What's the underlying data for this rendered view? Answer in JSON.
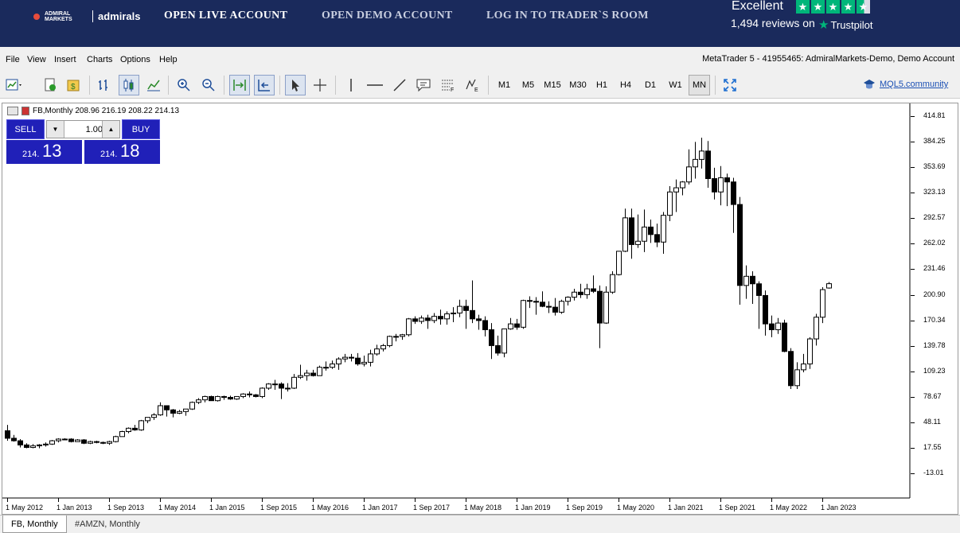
{
  "topbar": {
    "logo_small": "ADMIRAL MARKETS",
    "logo_big": "admirals",
    "links": [
      "OPEN LIVE ACCOUNT",
      "OPEN DEMO ACCOUNT",
      "LOG IN TO TRADER`S ROOM"
    ],
    "trustpilot": {
      "rating_word": "Excellent",
      "reviews": "1,494 reviews on",
      "brand": "Trustpilot",
      "stars": 4.5
    }
  },
  "menu": {
    "items": [
      "File",
      "View",
      "Insert",
      "Charts",
      "Options",
      "Help"
    ],
    "window_title": "MetaTrader 5 - 41955465: AdmiralMarkets-Demo, Demo Account"
  },
  "toolbar": {
    "timeframes": [
      "M1",
      "M5",
      "M15",
      "M30",
      "H1",
      "H4",
      "D1",
      "W1",
      "MN"
    ],
    "active_timeframe": "MN",
    "community_link": "MQL5.community"
  },
  "chart": {
    "header": "FB,Monthly  208.96 216.19 208.22 214.13",
    "trade_panel": {
      "sell_label": "SELL",
      "buy_label": "BUY",
      "volume": "1.00",
      "sell_small": "214.",
      "sell_big": "13",
      "buy_small": "214.",
      "buy_big": "18"
    }
  },
  "chart_data": {
    "type": "candlestick",
    "symbol": "FB",
    "timeframe": "Monthly",
    "ylim": [
      -13.01,
      414.81
    ],
    "yticks": [
      "414.81",
      "384.25",
      "353.69",
      "323.13",
      "292.57",
      "262.02",
      "231.46",
      "200.90",
      "170.34",
      "139.78",
      "109.23",
      "78.67",
      "48.11",
      "17.55",
      "-13.01"
    ],
    "xticks": [
      "1 May 2012",
      "1 Jan 2013",
      "1 Sep 2013",
      "1 May 2014",
      "1 Jan 2015",
      "1 Sep 2015",
      "1 May 2016",
      "1 Jan 2017",
      "1 Sep 2017",
      "1 May 2018",
      "1 Jan 2019",
      "1 Sep 2019",
      "1 May 2020",
      "1 Jan 2021",
      "1 Sep 2021",
      "1 May 2022",
      "1 Jan 2023"
    ],
    "ohlc": [
      [
        38,
        45,
        26,
        29
      ],
      [
        29,
        33,
        25,
        26
      ],
      [
        26,
        28,
        18,
        21
      ],
      [
        21,
        23,
        17,
        18
      ],
      [
        18,
        22,
        17,
        20
      ],
      [
        20,
        22,
        17,
        21
      ],
      [
        21,
        24,
        19,
        22
      ],
      [
        22,
        27,
        21,
        26
      ],
      [
        26,
        29,
        24,
        28
      ],
      [
        28,
        29,
        27,
        28
      ],
      [
        28,
        29,
        24,
        25
      ],
      [
        25,
        28,
        25,
        27
      ],
      [
        27,
        28,
        22,
        23
      ],
      [
        23,
        26,
        22,
        25
      ],
      [
        25,
        26,
        23,
        24
      ],
      [
        24,
        25,
        22,
        23
      ],
      [
        23,
        26,
        21,
        25
      ],
      [
        25,
        32,
        24,
        31
      ],
      [
        31,
        38,
        31,
        37
      ],
      [
        37,
        42,
        35,
        41
      ],
      [
        41,
        45,
        38,
        39
      ],
      [
        39,
        51,
        38,
        50
      ],
      [
        50,
        54,
        47,
        54
      ],
      [
        54,
        59,
        51,
        57
      ],
      [
        57,
        72,
        56,
        68
      ],
      [
        68,
        68,
        55,
        63
      ],
      [
        63,
        64,
        54,
        59
      ],
      [
        59,
        63,
        58,
        61
      ],
      [
        61,
        64,
        56,
        64
      ],
      [
        64,
        73,
        63,
        72
      ],
      [
        72,
        77,
        70,
        75
      ],
      [
        75,
        80,
        72,
        79
      ],
      [
        79,
        80,
        74,
        74
      ],
      [
        74,
        80,
        73,
        79
      ],
      [
        79,
        80,
        75,
        78
      ],
      [
        78,
        80,
        75,
        76
      ],
      [
        76,
        79,
        75,
        79
      ],
      [
        79,
        83,
        77,
        82
      ],
      [
        82,
        85,
        78,
        81
      ],
      [
        81,
        82,
        78,
        79
      ],
      [
        79,
        90,
        77,
        89
      ],
      [
        89,
        95,
        87,
        94
      ],
      [
        94,
        99,
        87,
        94
      ],
      [
        94,
        96,
        76,
        89
      ],
      [
        89,
        95,
        85,
        89
      ],
      [
        89,
        106,
        88,
        102
      ],
      [
        102,
        117,
        100,
        104
      ],
      [
        104,
        111,
        98,
        107
      ],
      [
        107,
        111,
        103,
        104
      ],
      [
        104,
        116,
        104,
        114
      ],
      [
        114,
        121,
        110,
        114
      ],
      [
        114,
        122,
        112,
        118
      ],
      [
        118,
        126,
        111,
        124
      ],
      [
        124,
        130,
        120,
        126
      ],
      [
        126,
        130,
        121,
        125
      ],
      [
        125,
        131,
        116,
        118
      ],
      [
        118,
        128,
        115,
        120
      ],
      [
        120,
        135,
        115,
        130
      ],
      [
        130,
        141,
        128,
        136
      ],
      [
        136,
        142,
        133,
        140
      ],
      [
        140,
        152,
        138,
        151
      ],
      [
        151,
        154,
        145,
        151
      ],
      [
        151,
        154,
        147,
        153
      ],
      [
        153,
        173,
        151,
        172
      ],
      [
        172,
        175,
        166,
        169
      ],
      [
        169,
        176,
        166,
        173
      ],
      [
        173,
        177,
        160,
        170
      ],
      [
        170,
        179,
        167,
        175
      ],
      [
        175,
        183,
        165,
        172
      ],
      [
        172,
        181,
        165,
        178
      ],
      [
        178,
        186,
        168,
        179
      ],
      [
        179,
        195,
        174,
        187
      ],
      [
        187,
        195,
        160,
        182
      ],
      [
        182,
        218,
        167,
        172
      ],
      [
        172,
        177,
        159,
        170
      ],
      [
        170,
        175,
        151,
        159
      ],
      [
        159,
        167,
        124,
        140
      ],
      [
        140,
        152,
        128,
        131
      ],
      [
        131,
        158,
        126,
        160
      ],
      [
        160,
        173,
        159,
        166
      ],
      [
        166,
        172,
        159,
        162
      ],
      [
        162,
        195,
        160,
        194
      ],
      [
        194,
        199,
        185,
        193
      ],
      [
        193,
        198,
        177,
        192
      ],
      [
        192,
        205,
        186,
        187
      ],
      [
        187,
        193,
        179,
        186
      ],
      [
        186,
        197,
        176,
        180
      ],
      [
        180,
        195,
        178,
        193
      ],
      [
        193,
        199,
        188,
        198
      ],
      [
        198,
        208,
        194,
        204
      ],
      [
        204,
        214,
        197,
        201
      ],
      [
        201,
        214,
        196,
        208
      ],
      [
        208,
        224,
        203,
        205
      ],
      [
        205,
        212,
        137,
        167
      ],
      [
        167,
        211,
        166,
        204
      ],
      [
        204,
        229,
        202,
        225
      ],
      [
        225,
        245,
        224,
        253
      ],
      [
        253,
        304,
        252,
        293
      ],
      [
        293,
        304,
        244,
        261
      ],
      [
        261,
        297,
        257,
        265
      ],
      [
        265,
        303,
        252,
        282
      ],
      [
        282,
        291,
        263,
        273
      ],
      [
        273,
        286,
        258,
        264
      ],
      [
        264,
        300,
        250,
        296
      ],
      [
        296,
        331,
        289,
        324
      ],
      [
        324,
        339,
        300,
        329
      ],
      [
        329,
        337,
        320,
        336
      ],
      [
        336,
        375,
        333,
        354
      ],
      [
        354,
        384,
        340,
        363
      ],
      [
        363,
        389,
        352,
        373
      ],
      [
        373,
        385,
        329,
        340
      ],
      [
        340,
        353,
        315,
        324
      ],
      [
        324,
        355,
        308,
        341
      ],
      [
        341,
        346,
        307,
        336
      ],
      [
        336,
        341,
        275,
        309
      ],
      [
        309,
        318,
        189,
        212
      ],
      [
        212,
        236,
        196,
        223
      ],
      [
        223,
        229,
        190,
        214
      ],
      [
        214,
        217,
        160,
        200
      ],
      [
        200,
        206,
        152,
        166
      ],
      [
        166,
        176,
        150,
        159
      ],
      [
        159,
        173,
        154,
        167
      ],
      [
        167,
        171,
        132,
        133
      ],
      [
        133,
        137,
        88,
        92
      ],
      [
        92,
        120,
        88,
        111
      ],
      [
        111,
        130,
        108,
        118
      ],
      [
        118,
        150,
        112,
        148
      ],
      [
        148,
        178,
        140,
        174
      ],
      [
        174,
        210,
        167,
        207
      ],
      [
        208.96,
        216.19,
        208.22,
        214.13
      ]
    ]
  },
  "tabs": [
    "FB, Monthly",
    "#AMZN, Monthly"
  ]
}
